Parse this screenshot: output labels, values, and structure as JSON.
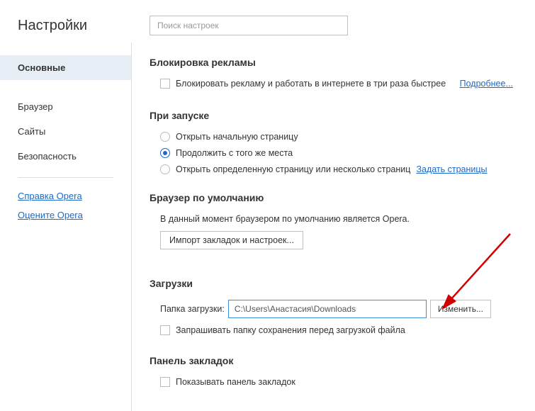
{
  "sidebar": {
    "title": "Настройки",
    "items": [
      {
        "label": "Основные"
      },
      {
        "label": "Браузер"
      },
      {
        "label": "Сайты"
      },
      {
        "label": "Безопасность"
      }
    ],
    "links": [
      {
        "label": "Справка Opera"
      },
      {
        "label": "Оцените Opera"
      }
    ]
  },
  "search": {
    "placeholder": "Поиск настроек"
  },
  "adblock": {
    "title": "Блокировка рекламы",
    "checkbox_label": "Блокировать рекламу и работать в интернете в три раза быстрее",
    "more_link": "Подробнее..."
  },
  "startup": {
    "title": "При запуске",
    "options": [
      {
        "label": "Открыть начальную страницу"
      },
      {
        "label": "Продолжить с того же места"
      },
      {
        "label": "Открыть определенную страницу или несколько страниц",
        "link": "Задать страницы"
      }
    ]
  },
  "default_browser": {
    "title": "Браузер по умолчанию",
    "status": "В данный момент браузером по умолчанию является Opera.",
    "import_button": "Импорт закладок и настроек..."
  },
  "downloads": {
    "title": "Загрузки",
    "folder_label": "Папка загрузки:",
    "folder_value": "C:\\Users\\Анастасия\\Downloads",
    "change_button": "Изменить...",
    "ask_checkbox": "Запрашивать папку сохранения перед загрузкой файла"
  },
  "bookmarks": {
    "title": "Панель закладок",
    "show_checkbox": "Показывать панель закладок"
  }
}
